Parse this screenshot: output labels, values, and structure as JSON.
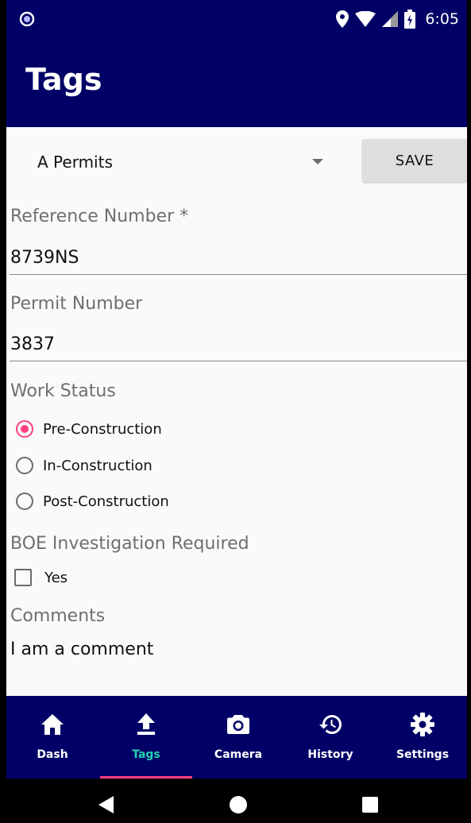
{
  "status_bar": {
    "time": "6:05",
    "icons": [
      "location-icon",
      "wifi-icon",
      "signal-icon",
      "battery-icon"
    ]
  },
  "app_bar": {
    "title": "Tags"
  },
  "form": {
    "category": {
      "selected": "A Permits"
    },
    "save_label": "SAVE",
    "reference_number": {
      "label": "Reference Number *",
      "value": "8739NS"
    },
    "permit_number": {
      "label": "Permit Number",
      "value": "3837"
    },
    "work_status": {
      "label": "Work Status",
      "options": [
        {
          "label": "Pre-Construction",
          "checked": true
        },
        {
          "label": "In-Construction",
          "checked": false
        },
        {
          "label": "Post-Construction",
          "checked": false
        }
      ]
    },
    "boe_investigation": {
      "label": "BOE Investigation Required",
      "option_label": "Yes",
      "checked": false
    },
    "comments": {
      "label": "Comments",
      "value": "I am a comment"
    }
  },
  "bottom_nav": {
    "items": [
      {
        "label": "Dash",
        "icon": "home-icon"
      },
      {
        "label": "Tags",
        "icon": "upload-icon",
        "active": true
      },
      {
        "label": "Camera",
        "icon": "camera-icon"
      },
      {
        "label": "History",
        "icon": "history-icon"
      },
      {
        "label": "Settings",
        "icon": "gear-icon"
      }
    ]
  },
  "colors": {
    "primary": "#000066",
    "accent": "#ff4081",
    "active_label": "#22d3b0",
    "background": "#fafafa"
  }
}
